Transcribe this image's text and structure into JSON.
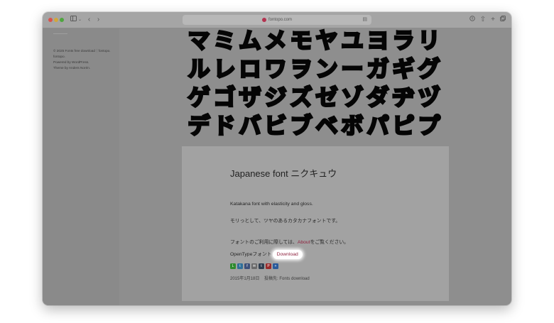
{
  "browser": {
    "url": "fontopo.com",
    "icons": {
      "sidebar": "sidebar-icon",
      "chevron": "chevron-down-icon",
      "back": "back-arrow-icon",
      "forward": "forward-arrow-icon",
      "reader": "reader-icon",
      "download": "download-icon",
      "share": "share-icon",
      "new_tab": "plus-icon",
      "tabs": "tabs-icon"
    }
  },
  "sidebar": {
    "footer_lines": [
      "© 2025 Fonts free download｜fontopo.",
      "Powered by WordPress.",
      "Theme by Anders Norén."
    ]
  },
  "banner": {
    "rows": [
      [
        "マ",
        "ミ",
        "ム",
        "メ",
        "モ",
        "ヤ",
        "ユ",
        "ヨ",
        "ラ",
        "リ"
      ],
      [
        "ル",
        "レ",
        "ロ",
        "ワ",
        "ヲ",
        "ン",
        "ー",
        "ガ",
        "ギ",
        "グ"
      ],
      [
        "ゲ",
        "ゴ",
        "ザ",
        "ジ",
        "ズ",
        "ゼ",
        "ゾ",
        "ダ",
        "ヂ",
        "ヅ"
      ],
      [
        "デ",
        "ド",
        "バ",
        "ビ",
        "ブ",
        "ベ",
        "ボ",
        "パ",
        "ピ",
        "プ"
      ]
    ]
  },
  "post": {
    "title": "Japanese font ニクキュウ",
    "desc_en": "Katakana font with elasticity and gloss.",
    "desc_jp": "モリっとして、ツヤのあるカタカナフォントです。",
    "usage_prefix": "フォントのご利用に際しては、",
    "usage_link": "About",
    "usage_suffix": "をご覧ください。",
    "opentype_label": "OpenTypeフォント",
    "download_label": "Download",
    "share_icons": [
      {
        "name": "line-share-icon",
        "glyph": "L",
        "color": "#2e8a2e"
      },
      {
        "name": "twitter-share-icon",
        "glyph": "t",
        "color": "#2f6f9a"
      },
      {
        "name": "facebook-share-icon",
        "glyph": "f",
        "color": "#3c4f7a"
      },
      {
        "name": "email-share-icon",
        "glyph": "✉",
        "color": "#6a6a6a"
      },
      {
        "name": "tumblr-share-icon",
        "glyph": "t",
        "color": "#2f3e50"
      },
      {
        "name": "pinterest-share-icon",
        "glyph": "P",
        "color": "#9a2a2a"
      },
      {
        "name": "more-share-icon",
        "glyph": "+",
        "color": "#2a5a9a"
      }
    ],
    "date": "2015年1月18日",
    "category": "投稿先: Fonts download"
  }
}
